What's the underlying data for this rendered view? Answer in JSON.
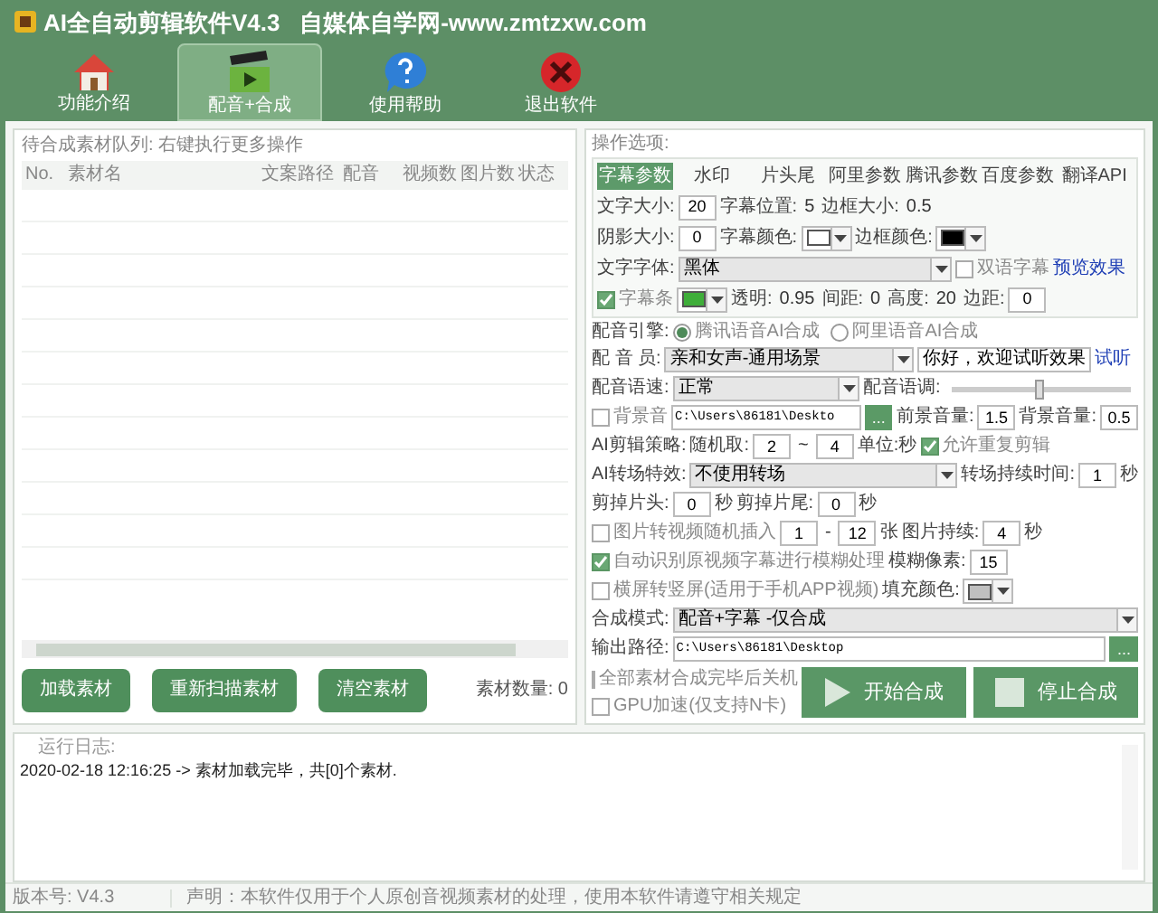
{
  "window": {
    "title": "AI全自动剪辑软件V4.3   自媒体自学网-www.zmtzxw.com"
  },
  "toolbar": [
    {
      "label": "功能介绍",
      "selected": false
    },
    {
      "label": "配音+合成",
      "selected": true
    },
    {
      "label": "使用帮助",
      "selected": false
    },
    {
      "label": "退出软件",
      "selected": false
    }
  ],
  "queue": {
    "title": "待合成素材队列: 右键执行更多操作",
    "columns": [
      "No.",
      "素材名",
      "文案路径",
      "配音",
      "视频数",
      "图片数",
      "状态"
    ],
    "buttons": [
      "加载素材",
      "重新扫描素材",
      "清空素材"
    ],
    "count": "素材数量: 0"
  },
  "options": {
    "title": "操作选项:",
    "tabs": [
      {
        "label": "字幕参数",
        "selected": true
      },
      {
        "label": "水印",
        "selected": false
      },
      {
        "label": "片头尾",
        "selected": false
      },
      {
        "label": "阿里参数",
        "selected": false
      },
      {
        "label": "腾讯参数",
        "selected": false
      },
      {
        "label": "百度参数",
        "selected": false
      },
      {
        "label": "翻译API",
        "selected": false
      }
    ],
    "tab_rows": [
      {
        "items": [
          {
            "kind": "label",
            "text": "文字大小:"
          },
          {
            "kind": "input",
            "value": "20"
          },
          {
            "kind": "label",
            "text": "字幕位置:"
          },
          {
            "kind": "value",
            "text": "5"
          },
          {
            "kind": "label",
            "text": "边框大小:"
          },
          {
            "kind": "value",
            "text": "0.5"
          }
        ]
      },
      {
        "items": [
          {
            "kind": "label",
            "text": "阴影大小:"
          },
          {
            "kind": "input",
            "value": "0"
          },
          {
            "kind": "label",
            "text": "字幕颜色:"
          },
          {
            "kind": "swatch",
            "color": "#ffffff"
          },
          {
            "kind": "label",
            "text": "边框颜色:"
          },
          {
            "kind": "swatch",
            "color": "#000000"
          }
        ]
      },
      {
        "items": [
          {
            "kind": "label",
            "text": "文字字体:"
          },
          {
            "kind": "select",
            "value": "黑体"
          },
          {
            "kind": "check",
            "label": "双语字幕",
            "checked": false
          },
          {
            "kind": "link",
            "text": "预览效果"
          }
        ]
      },
      {
        "items": [
          {
            "kind": "check",
            "label": "字幕条",
            "checked": true
          },
          {
            "kind": "swatch",
            "color": "#3fae3a"
          },
          {
            "kind": "label",
            "text": "透明:"
          },
          {
            "kind": "value",
            "text": "0.95"
          },
          {
            "kind": "label",
            "text": "间距:"
          },
          {
            "kind": "value",
            "text": "0"
          },
          {
            "kind": "label",
            "text": "高度:"
          },
          {
            "kind": "value",
            "text": "20"
          },
          {
            "kind": "label",
            "text": "边距:"
          },
          {
            "kind": "input",
            "value": "0"
          }
        ]
      }
    ],
    "rows": [
      {
        "items": [
          {
            "kind": "label",
            "text": "配音引擎:"
          },
          {
            "kind": "radio",
            "label": "腾讯语音AI合成",
            "selected": true
          },
          {
            "kind": "radio",
            "label": "阿里语音AI合成",
            "selected": false
          }
        ]
      },
      {
        "items": [
          {
            "kind": "label",
            "text": "配 音 员:"
          },
          {
            "kind": "select",
            "value": "亲和女声-通用场景"
          },
          {
            "kind": "field",
            "value": "你好，欢迎试听效果"
          },
          {
            "kind": "link",
            "text": "试听"
          }
        ]
      },
      {
        "items": [
          {
            "kind": "label",
            "text": "配音语速:"
          },
          {
            "kind": "select",
            "value": "正常"
          },
          {
            "kind": "label",
            "text": "配音语调:"
          },
          {
            "kind": "slider",
            "level": 0.5
          }
        ]
      },
      {
        "items": [
          {
            "kind": "check",
            "label": "背景音",
            "checked": false
          },
          {
            "kind": "path",
            "value": "C:\\Users\\86181\\Deskto"
          },
          {
            "kind": "browse",
            "text": "..."
          },
          {
            "kind": "label",
            "text": "前景音量:"
          },
          {
            "kind": "input",
            "value": "1.5"
          },
          {
            "kind": "label",
            "text": "背景音量:"
          },
          {
            "kind": "input",
            "value": "0.5"
          }
        ]
      },
      {
        "items": [
          {
            "kind": "label",
            "text": "AI剪辑策略:"
          },
          {
            "kind": "label",
            "text": "随机取:"
          },
          {
            "kind": "input",
            "value": "2"
          },
          {
            "kind": "value",
            "text": "~"
          },
          {
            "kind": "input",
            "value": "4"
          },
          {
            "kind": "label",
            "text": "单位:秒"
          },
          {
            "kind": "check",
            "label": "允许重复剪辑",
            "checked": true
          }
        ]
      },
      {
        "items": [
          {
            "kind": "label",
            "text": "AI转场特效:"
          },
          {
            "kind": "select",
            "value": "不使用转场"
          },
          {
            "kind": "label",
            "text": "转场持续时间:"
          },
          {
            "kind": "input",
            "value": "1"
          },
          {
            "kind": "label",
            "text": "秒"
          }
        ]
      },
      {
        "items": [
          {
            "kind": "label",
            "text": "剪掉片头:"
          },
          {
            "kind": "input",
            "value": "0"
          },
          {
            "kind": "label",
            "text": "秒"
          },
          {
            "kind": "label",
            "text": "剪掉片尾:"
          },
          {
            "kind": "input",
            "value": "0"
          },
          {
            "kind": "label",
            "text": "秒"
          }
        ]
      },
      {
        "items": [
          {
            "kind": "check",
            "label": "图片转视频随机插入",
            "checked": false
          },
          {
            "kind": "input",
            "value": "1"
          },
          {
            "kind": "value",
            "text": "-"
          },
          {
            "kind": "input",
            "value": "12"
          },
          {
            "kind": "label",
            "text": "张"
          },
          {
            "kind": "label",
            "text": "图片持续:"
          },
          {
            "kind": "input",
            "value": "4"
          },
          {
            "kind": "label",
            "text": "秒"
          }
        ]
      },
      {
        "items": [
          {
            "kind": "check",
            "label": "自动识别原视频字幕进行模糊处理",
            "checked": true
          },
          {
            "kind": "label",
            "text": "模糊像素:"
          },
          {
            "kind": "input",
            "value": "15"
          }
        ]
      },
      {
        "items": [
          {
            "kind": "check",
            "label": "横屏转竖屏(适用于手机APP视频)",
            "checked": false
          },
          {
            "kind": "label",
            "text": "填充颜色:"
          },
          {
            "kind": "swatch",
            "color": "#c0c0c0"
          }
        ]
      },
      {
        "items": [
          {
            "kind": "label",
            "text": "合成模式:"
          },
          {
            "kind": "select",
            "value": "配音+字幕 -仅合成"
          }
        ]
      },
      {
        "items": [
          {
            "kind": "label",
            "text": "输出路径:"
          },
          {
            "kind": "path",
            "value": "C:\\Users\\86181\\Desktop"
          },
          {
            "kind": "browse",
            "text": "..."
          }
        ]
      }
    ],
    "footer_checks": [
      {
        "label": "全部素材合成完毕后关机",
        "checked": false
      },
      {
        "label": "GPU加速(仅支持N卡)",
        "checked": false
      }
    ],
    "actions": [
      "开始合成",
      "停止合成"
    ]
  },
  "log": {
    "title": "运行日志:",
    "lines": [
      "2020-02-18 12:16:25 -> 素材加载完毕，共[0]个素材."
    ]
  },
  "status_bar": {
    "version": "版本号: V4.3",
    "notice": "声明：本软件仅用于个人原创音视频素材的处理，使用本软件请遵守相关规定"
  }
}
